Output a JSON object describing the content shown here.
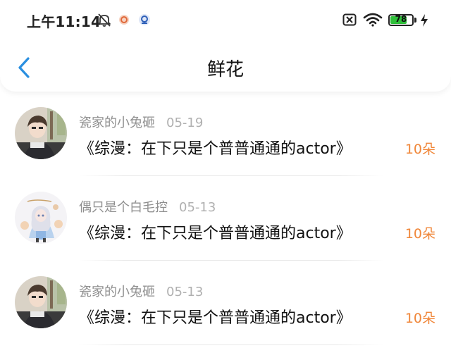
{
  "status_bar": {
    "time": "上午11:14",
    "battery_level": "78",
    "battery_fraction": 0.78,
    "icons": [
      "bell-off-icon",
      "app-notification-icon",
      "app-notification-icon-2",
      "sim-off-icon",
      "wifi-icon",
      "battery-icon",
      "charging-icon"
    ]
  },
  "header": {
    "title": "鲜花",
    "back_icon": "chevron-left-icon"
  },
  "colors": {
    "accent": "#2a8fe0",
    "count": "#f0873a",
    "battery": "#2fbf3a"
  },
  "items": [
    {
      "name": "瓷家的小兔砸",
      "date": "05-19",
      "book": "《综漫：在下只是个普普通通的actor》",
      "count": "10朵",
      "avatar": "anime-boy-avatar"
    },
    {
      "name": "偶只是个白毛控",
      "date": "05-13",
      "book": "《综漫：在下只是个普普通通的actor》",
      "count": "10朵",
      "avatar": "anime-girl-avatar"
    },
    {
      "name": "瓷家的小兔砸",
      "date": "05-13",
      "book": "《综漫：在下只是个普普通通的actor》",
      "count": "10朵",
      "avatar": "anime-boy-avatar"
    }
  ]
}
